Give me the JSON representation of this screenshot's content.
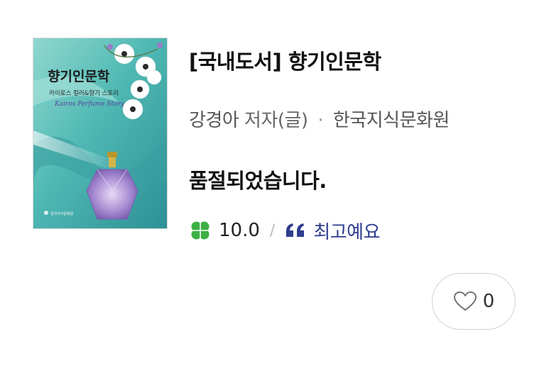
{
  "book": {
    "title": "[국내도서] 향기인문학",
    "author": "강경아",
    "author_role": "저자(글)",
    "separator": "·",
    "publisher": "한국지식문화원",
    "status": "품절되었습니다.",
    "cover": {
      "title": "향기인문학",
      "subtitle": "카이로스 컬러&향기 스토리",
      "script": "Kairos Perfume Story",
      "publisher_mark": "한국지식문화원"
    }
  },
  "rating": {
    "icon": "clover-icon",
    "score": "10.0",
    "divider": "/",
    "review_icon": "quote-icon",
    "review_label": "최고예요"
  },
  "like": {
    "icon": "heart-icon",
    "count": "0"
  },
  "colors": {
    "clover": "#3cb043",
    "review": "#2f3d8f",
    "cover_teal": "#5fc3bd"
  }
}
